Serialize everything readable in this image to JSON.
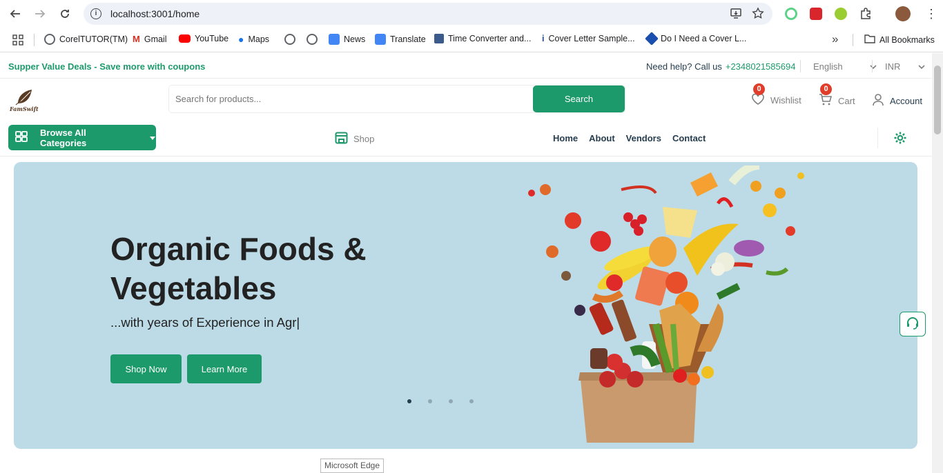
{
  "browser": {
    "url": "localhost:3001/home",
    "bookmarks": [
      "CorelTUTOR(TM)",
      "Gmail",
      "YouTube",
      "Maps",
      "News",
      "Translate",
      "Time Converter and...",
      "Cover Letter Sample...",
      "Do I Need a Cover L..."
    ],
    "all_bookmarks": "All Bookmarks",
    "overflow": "»"
  },
  "topbar": {
    "deals": "Supper Value Deals - Save more with coupons",
    "help_text": "Need help? Call us",
    "phone": "+2348021585694",
    "language": "English",
    "currency": "INR"
  },
  "header": {
    "logo_text": "FamSwift",
    "search_placeholder": "Search for products...",
    "search_button": "Search",
    "wishlist": {
      "label": "Wishlist",
      "count": "0"
    },
    "cart": {
      "label": "Cart",
      "count": "0"
    },
    "account": "Account"
  },
  "nav": {
    "browse": "Browse All Categories",
    "shop": "Shop",
    "items": [
      "Home",
      "About",
      "Vendors",
      "Contact"
    ]
  },
  "hero": {
    "title": "Organic Foods & Vegetables",
    "subtitle": "...with years of Experience in Agr|",
    "shop_now": "Shop Now",
    "learn_more": "Learn More",
    "slides": 4,
    "active_slide": 1
  },
  "tooltip": "Microsoft Edge",
  "colors": {
    "brand": "#1d9a6c",
    "hero_bg": "#bcdbe6",
    "badge": "#e03d2b"
  }
}
